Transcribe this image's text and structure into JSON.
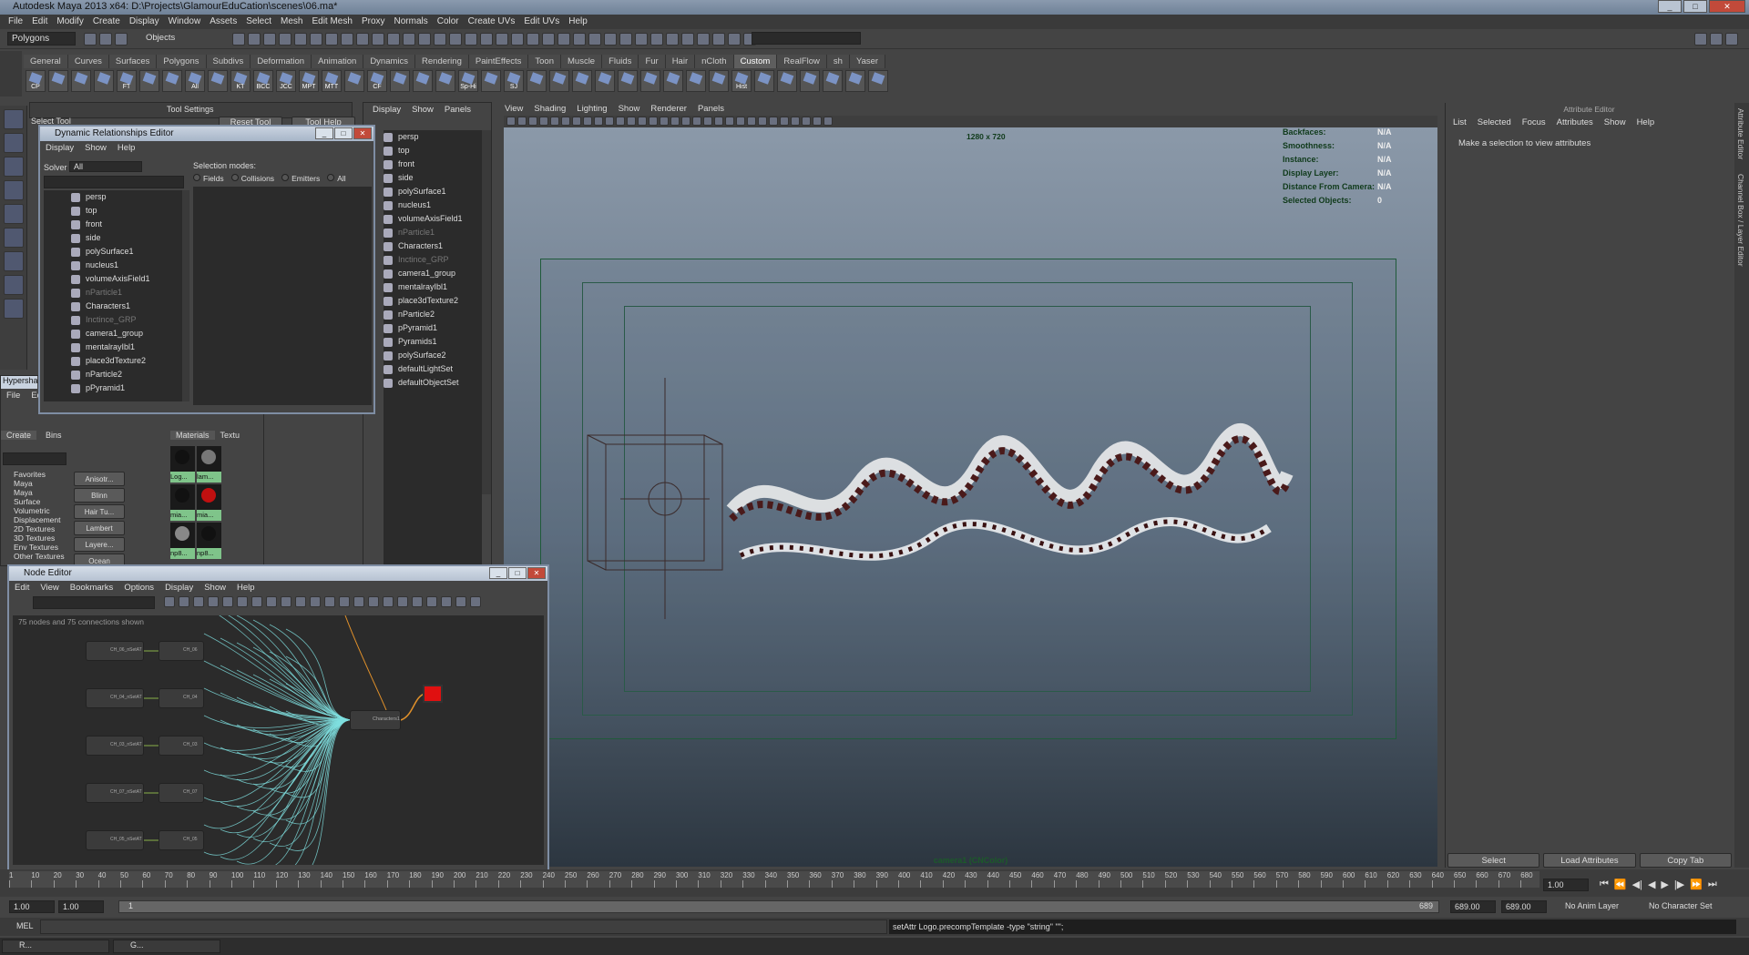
{
  "window": {
    "title": "Autodesk Maya 2013 x64: D:\\Projects\\GlamourEduCation\\scenes\\06.ma*"
  },
  "menubar": [
    "File",
    "Edit",
    "Modify",
    "Create",
    "Display",
    "Window",
    "Assets",
    "Select",
    "Mesh",
    "Edit Mesh",
    "Proxy",
    "Normals",
    "Color",
    "Create UVs",
    "Edit UVs",
    "Help"
  ],
  "statusline": {
    "mode": "Polygons",
    "objects_label": "Objects"
  },
  "shelf": {
    "tabs": [
      "General",
      "Curves",
      "Surfaces",
      "Polygons",
      "Subdivs",
      "Deformation",
      "Animation",
      "Dynamics",
      "Rendering",
      "PaintEffects",
      "Toon",
      "Muscle",
      "Fluids",
      "Fur",
      "Hair",
      "nCloth",
      "Custom",
      "RealFlow",
      "sh",
      "Yaser"
    ],
    "active_tab": "Custom",
    "icons": [
      "CP",
      "",
      "",
      "",
      "FT",
      "",
      "",
      "All",
      "",
      "KT",
      "BCC",
      "JCC",
      "MPT",
      "MTT",
      "",
      "CF",
      "",
      "",
      "",
      "Sp-Hi",
      "",
      "SJ",
      "",
      "",
      "",
      "",
      "",
      "",
      "",
      "",
      "",
      "Hist",
      "",
      "",
      "",
      "",
      "",
      ""
    ]
  },
  "tool_settings": {
    "title": "Tool Settings",
    "tool": "Select Tool",
    "reset": "Reset Tool",
    "help": "Tool Help"
  },
  "dre": {
    "title": "Dynamic Relationships Editor",
    "menu": [
      "Display",
      "Show",
      "Help"
    ],
    "solver_label": "Solver",
    "solver_value": "All",
    "selection_modes_label": "Selection modes:",
    "modes": [
      "Fields",
      "Collisions",
      "Emitters",
      "All"
    ],
    "items": [
      {
        "label": "persp",
        "dim": false
      },
      {
        "label": "top",
        "dim": false
      },
      {
        "label": "front",
        "dim": false
      },
      {
        "label": "side",
        "dim": false
      },
      {
        "label": "polySurface1",
        "dim": false
      },
      {
        "label": "nucleus1",
        "dim": false
      },
      {
        "label": "volumeAxisField1",
        "dim": false
      },
      {
        "label": "nParticle1",
        "dim": true
      },
      {
        "label": "Characters1",
        "dim": false
      },
      {
        "label": "Inctince_GRP",
        "dim": true
      },
      {
        "label": "camera1_group",
        "dim": false
      },
      {
        "label": "mentalrayIbl1",
        "dim": false
      },
      {
        "label": "place3dTexture2",
        "dim": false
      },
      {
        "label": "nParticle2",
        "dim": false
      },
      {
        "label": "pPyramid1",
        "dim": false
      }
    ]
  },
  "outliner": {
    "menu": [
      "Display",
      "Show",
      "Panels"
    ],
    "items": [
      {
        "label": "persp",
        "dim": false
      },
      {
        "label": "top",
        "dim": false
      },
      {
        "label": "front",
        "dim": false
      },
      {
        "label": "side",
        "dim": false
      },
      {
        "label": "polySurface1",
        "dim": false
      },
      {
        "label": "nucleus1",
        "dim": false
      },
      {
        "label": "volumeAxisField1",
        "dim": false
      },
      {
        "label": "nParticle1",
        "dim": true
      },
      {
        "label": "Characters1",
        "dim": false
      },
      {
        "label": "Inctince_GRP",
        "dim": true
      },
      {
        "label": "camera1_group",
        "dim": false
      },
      {
        "label": "mentalrayIbl1",
        "dim": false
      },
      {
        "label": "place3dTexture2",
        "dim": false
      },
      {
        "label": "nParticle2",
        "dim": false
      },
      {
        "label": "pPyramid1",
        "dim": false
      },
      {
        "label": "Pyramids1",
        "dim": false
      },
      {
        "label": "polySurface2",
        "dim": false
      },
      {
        "label": "defaultLightSet",
        "dim": false
      },
      {
        "label": "defaultObjectSet",
        "dim": false
      }
    ]
  },
  "hypershade": {
    "title": "Hypersha",
    "menu": [
      "File",
      "Edit"
    ],
    "tabs": [
      "Create",
      "Bins"
    ],
    "mat_tabs": [
      "Materials",
      "Textu"
    ],
    "tree": [
      "Favorites",
      "Maya",
      "Maya",
      "Surface",
      "Volumetric",
      "Displacement",
      "2D Textures",
      "3D Textures",
      "Env Textures",
      "Other Textures"
    ],
    "nodes": [
      "Anisotr...",
      "Blinn",
      "Hair Tu...",
      "Lambert",
      "Layere...",
      "Ocean"
    ],
    "swatches": [
      "Log...",
      "lam...",
      "mia...",
      "mia...",
      "np8...",
      "np8..."
    ]
  },
  "node_editor": {
    "title": "Node Editor",
    "menu": [
      "Edit",
      "View",
      "Bookmarks",
      "Options",
      "Display",
      "Show",
      "Help"
    ],
    "status": "75 nodes and 75 connections shown",
    "left_nodes": [
      "CH_06_nSetAT",
      "CH_04_nSetAT",
      "CH_03_nSetAT",
      "CH_07_nSetAT",
      "CH_05_nSetAT"
    ],
    "mid_nodes": [
      "CH_06",
      "CH_04",
      "CH_03",
      "CH_07",
      "CH_05"
    ],
    "main_node": "Characters1"
  },
  "viewport": {
    "menu": [
      "View",
      "Shading",
      "Lighting",
      "Show",
      "Renderer",
      "Panels"
    ],
    "resolution": "1280 x 720",
    "camera_label": "camera1 (CNColor)",
    "hud": [
      {
        "k": "Backfaces:",
        "v": "N/A"
      },
      {
        "k": "Smoothness:",
        "v": "N/A"
      },
      {
        "k": "Instance:",
        "v": "N/A"
      },
      {
        "k": "Display Layer:",
        "v": "N/A"
      },
      {
        "k": "Distance From Camera:",
        "v": "N/A"
      },
      {
        "k": "Selected Objects:",
        "v": "0"
      }
    ]
  },
  "attribute_editor": {
    "title": "Attribute Editor",
    "menu": [
      "List",
      "Selected",
      "Focus",
      "Attributes",
      "Show",
      "Help"
    ],
    "message": "Make a selection to view attributes",
    "buttons": [
      "Select",
      "Load Attributes",
      "Copy Tab"
    ],
    "side_tabs": [
      "Attribute Editor",
      "Channel Box / Layer Editor"
    ]
  },
  "timeline": {
    "ticks": [
      "1",
      "10",
      "20",
      "30",
      "40",
      "50",
      "60",
      "70",
      "80",
      "90",
      "100",
      "110",
      "120",
      "130",
      "140",
      "150",
      "160",
      "170",
      "180",
      "190",
      "200",
      "210",
      "220",
      "230",
      "240",
      "250",
      "260",
      "270",
      "280",
      "290",
      "300",
      "310",
      "320",
      "330",
      "340",
      "350",
      "360",
      "370",
      "380",
      "390",
      "400",
      "410",
      "420",
      "430",
      "440",
      "450",
      "460",
      "470",
      "480",
      "490",
      "500",
      "510",
      "520",
      "530",
      "540",
      "550",
      "560",
      "570",
      "580",
      "590",
      "600",
      "610",
      "620",
      "630",
      "640",
      "650",
      "660",
      "670",
      "680"
    ],
    "current": "1.00"
  },
  "range": {
    "start": "1.00",
    "start2": "1.00",
    "slider_start": "1",
    "slider_end": "689",
    "end1": "689.00",
    "end2": "689.00",
    "anim_layer": "No Anim Layer",
    "char_set": "No Character Set"
  },
  "cmdline": {
    "label": "MEL",
    "result": "setAttr Logo.precompTemplate -type \"string\" \"\";"
  },
  "taskbar": [
    "R...",
    "G..."
  ]
}
